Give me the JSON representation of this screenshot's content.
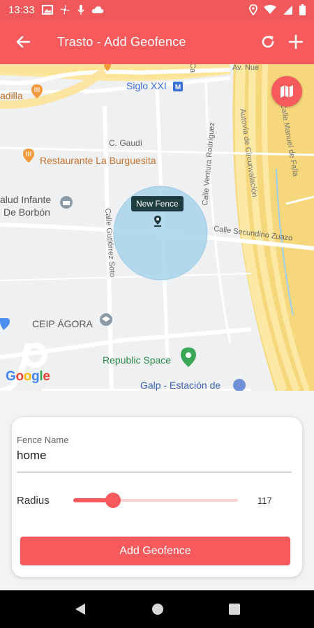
{
  "status_bar": {
    "time": "13:33",
    "icons": [
      "gallery-icon",
      "fan-icon",
      "mic-icon",
      "cloud-icon"
    ],
    "right_icons": [
      "location-icon",
      "wifi-icon",
      "signal-icon",
      "battery-icon"
    ]
  },
  "app_bar": {
    "title": "Trasto - Add Geofence",
    "back_icon": "arrow-left-icon",
    "refresh_icon": "refresh-icon",
    "add_icon": "plus-icon"
  },
  "map": {
    "labels": {
      "siglo": "Siglo XXI",
      "cgaudi": "C. Gaudí",
      "restaurante": "Restaurante La Burguesita",
      "salud1": "alud Infante",
      "salud2": "De Borbón",
      "agora": "CEIP ÁGORA",
      "republic": "Republic Space",
      "galp": "Galp - Estación de",
      "adilla": "adilla",
      "ventura": "Calle Ventura Rodríguez",
      "gutierrez": "Calle Gutiérrez Soto",
      "secundino": "Calle Secundino Zuazo",
      "autovia": "Autovía de Circunvalación",
      "manuel": "Calle Manuel de Falla",
      "avnue": "Av. Nue",
      "ca": "Ca"
    },
    "fence_tooltip": "New Fence",
    "google_logo": "Google",
    "map_type_icon": "map-icon"
  },
  "form": {
    "fence_name_label": "Fence Name",
    "fence_name_value": "home",
    "radius_label": "Radius",
    "radius_value": "117",
    "radius_fraction": 0.19,
    "submit_label": "Add Geofence"
  },
  "nav_bar": {
    "icons": [
      "back-triangle-icon",
      "home-circle-icon",
      "recents-square-icon"
    ]
  },
  "colors": {
    "accent": "#f65a5c",
    "status_bar": "#f0585b",
    "fence_circle": "#a8d3ea",
    "tooltip_bg": "#1f3d40",
    "highway": "#fce8a3"
  }
}
